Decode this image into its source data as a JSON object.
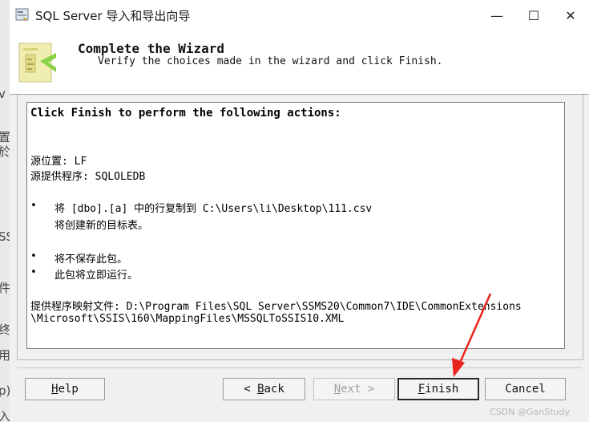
{
  "window": {
    "title": "SQL Server 导入和导出向导",
    "minimize_glyph": "—",
    "maximize_glyph": "☐",
    "close_glyph": "✕"
  },
  "background_fragments": [
    "v",
    "置",
    "於",
    "SS",
    "件",
    "终",
    "用",
    "p)",
    "入密码(K):"
  ],
  "header": {
    "title": "Complete the Wizard",
    "subtitle": "Verify the choices made in the wizard and click Finish."
  },
  "summary": {
    "heading": "Click Finish to perform the following actions:",
    "source_location": "源位置: LF",
    "source_provider": "源提供程序: SQLOLEDB",
    "bullets": [
      {
        "line1": "将 [dbo].[a] 中的行复制到 C:\\Users\\li\\Desktop\\111.csv",
        "line2": "将创建新的目标表。"
      },
      {
        "line1": "将不保存此包。"
      },
      {
        "line1": "此包将立即运行。"
      }
    ],
    "bullet_char": "•",
    "mapping_line1": "提供程序映射文件: D:\\Program Files\\SQL Server\\SSMS20\\Common7\\IDE\\CommonExtensions",
    "mapping_line2": "\\Microsoft\\SSIS\\160\\MappingFiles\\MSSQLToSSIS10.XML"
  },
  "buttons": {
    "help": {
      "mnemonic": "H",
      "rest": "elp"
    },
    "back": {
      "prefix": "< ",
      "mnemonic": "B",
      "rest": "ack"
    },
    "next": {
      "mnemonic": "N",
      "rest": "ext >"
    },
    "finish": {
      "mnemonic": "F",
      "rest": "inish"
    },
    "cancel": {
      "label": "Cancel"
    }
  },
  "colors": {
    "annotation_arrow": "#e8231b",
    "wizard_icon_green": "#8bd14a",
    "wizard_icon_yellow": "#e9e38a"
  },
  "watermark": "CSDN @GanStudy"
}
